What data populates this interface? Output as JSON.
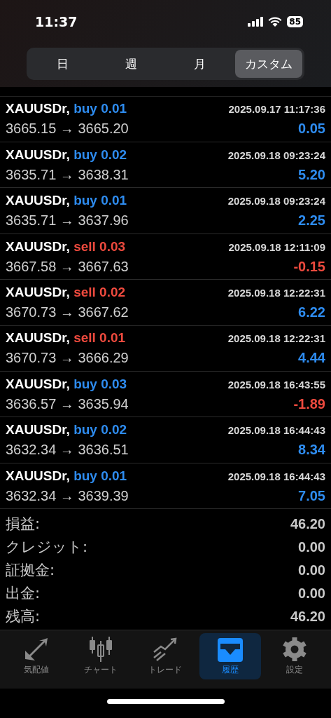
{
  "status_bar": {
    "time": "11:37",
    "battery": "85"
  },
  "segments": [
    {
      "label": "日",
      "selected": false
    },
    {
      "label": "週",
      "selected": false
    },
    {
      "label": "月",
      "selected": false
    },
    {
      "label": "カスタム",
      "selected": true
    }
  ],
  "deals": [
    {
      "symbol": "XAUUSDr,",
      "order": "buy 0.01",
      "kind": "buy",
      "time": "2025.09.17 11:17:36",
      "prices": "3665.15 → 3665.20",
      "profit": "0.05",
      "loss": false
    },
    {
      "symbol": "XAUUSDr,",
      "order": "buy 0.02",
      "kind": "buy",
      "time": "2025.09.18 09:23:24",
      "prices": "3635.71 → 3638.31",
      "profit": "5.20",
      "loss": false
    },
    {
      "symbol": "XAUUSDr,",
      "order": "buy 0.01",
      "kind": "buy",
      "time": "2025.09.18 09:23:24",
      "prices": "3635.71 → 3637.96",
      "profit": "2.25",
      "loss": false
    },
    {
      "symbol": "XAUUSDr,",
      "order": "sell 0.03",
      "kind": "sell",
      "time": "2025.09.18 12:11:09",
      "prices": "3667.58 → 3667.63",
      "profit": "-0.15",
      "loss": true
    },
    {
      "symbol": "XAUUSDr,",
      "order": "sell 0.02",
      "kind": "sell",
      "time": "2025.09.18 12:22:31",
      "prices": "3670.73 → 3667.62",
      "profit": "6.22",
      "loss": false
    },
    {
      "symbol": "XAUUSDr,",
      "order": "sell 0.01",
      "kind": "sell",
      "time": "2025.09.18 12:22:31",
      "prices": "3670.73 → 3666.29",
      "profit": "4.44",
      "loss": false
    },
    {
      "symbol": "XAUUSDr,",
      "order": "buy 0.03",
      "kind": "buy",
      "time": "2025.09.18 16:43:55",
      "prices": "3636.57 → 3635.94",
      "profit": "-1.89",
      "loss": true
    },
    {
      "symbol": "XAUUSDr,",
      "order": "buy 0.02",
      "kind": "buy",
      "time": "2025.09.18 16:44:43",
      "prices": "3632.34 → 3636.51",
      "profit": "8.34",
      "loss": false
    },
    {
      "symbol": "XAUUSDr,",
      "order": "buy 0.01",
      "kind": "buy",
      "time": "2025.09.18 16:44:43",
      "prices": "3632.34 → 3639.39",
      "profit": "7.05",
      "loss": false
    }
  ],
  "summary": [
    {
      "label": "損益:",
      "value": "46.20"
    },
    {
      "label": "クレジット:",
      "value": "0.00"
    },
    {
      "label": "証拠金:",
      "value": "0.00"
    },
    {
      "label": "出金:",
      "value": "0.00"
    },
    {
      "label": "残高:",
      "value": "46.20"
    }
  ],
  "tab_bar": [
    {
      "kind": "quotes",
      "label": "気配値",
      "selected": false
    },
    {
      "kind": "chart",
      "label": "チャート",
      "selected": false
    },
    {
      "kind": "trade",
      "label": "トレード",
      "selected": false
    },
    {
      "kind": "history",
      "label": "履歴",
      "selected": true
    },
    {
      "kind": "settings",
      "label": "設定",
      "selected": false
    }
  ]
}
